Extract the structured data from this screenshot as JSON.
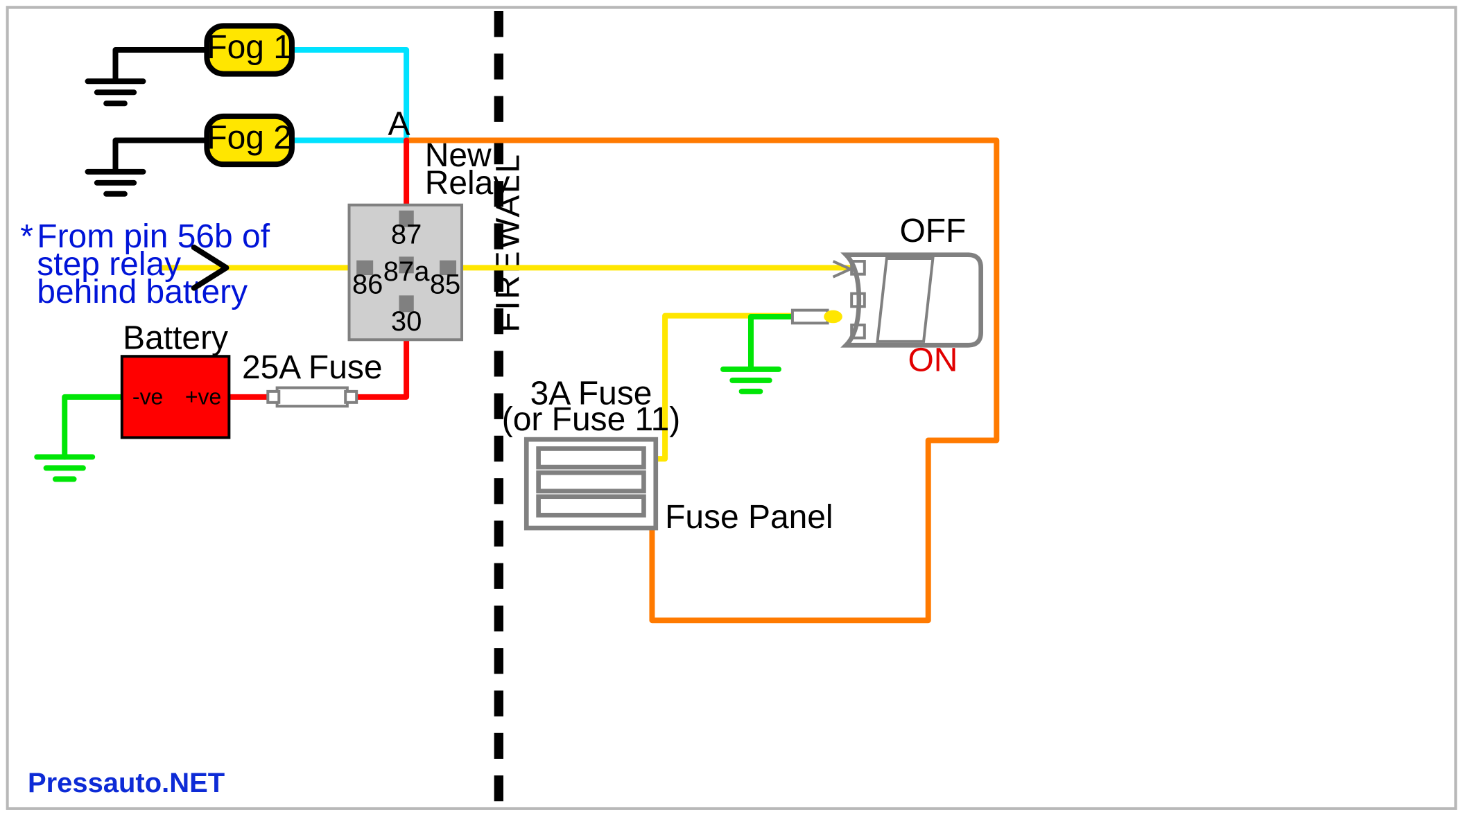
{
  "fogs": {
    "1": "Fog 1",
    "2": "Fog 2"
  },
  "nodeA": "A",
  "relay": {
    "title": "New\nRelay",
    "p87": "87",
    "p87a": "87a",
    "p86": "86",
    "p85": "85",
    "p30": "30"
  },
  "battery": {
    "title": "Battery",
    "neg": "-ve",
    "pos": "+ve"
  },
  "fuse25": "25A Fuse",
  "note": "From pin 56b of\nstep relay\nbehind battery",
  "firewall": "FIREWALL",
  "fuse3": {
    "title": "3A Fuse\n(or Fuse 11)",
    "caption": "Fuse Panel"
  },
  "switch": {
    "off": "OFF",
    "on": "ON"
  },
  "watermark": "Pressauto.NET",
  "colors": {
    "cyan": "#00e2ff",
    "orange": "#ff7a00",
    "yellow": "#ffe600",
    "red": "#ff0000",
    "green": "#00e606",
    "fogFill": "#ffe600",
    "fogStroke": "#000",
    "relayFill": "#cfcfcf",
    "relayStroke": "#808080",
    "pinFill": "#808080",
    "battFill": "#ff0000",
    "fuseStroke": "#808080",
    "switchStroke": "#808080"
  }
}
